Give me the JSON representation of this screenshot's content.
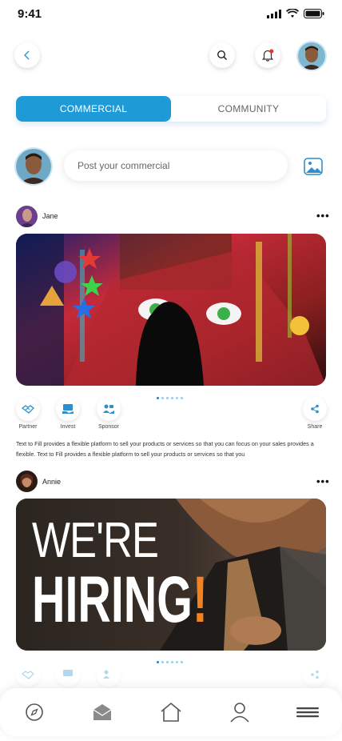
{
  "status": {
    "time": "9:41"
  },
  "tabs": [
    {
      "label": "COMMERCIAL",
      "active": true
    },
    {
      "label": "COMMUNITY",
      "active": false
    }
  ],
  "composer": {
    "placeholder": "Post your commercial"
  },
  "posts": [
    {
      "author": "Jane",
      "actions": [
        {
          "label": "Partner",
          "icon": "handshake-icon"
        },
        {
          "label": "Invest",
          "icon": "invest-icon"
        },
        {
          "label": "Sponsor",
          "icon": "sponsor-icon"
        }
      ],
      "share_label": "Share",
      "caption": "Text to Fill provides a flexible platform to sell your products or  services so that you can focus on your sales provides a flexible. Text to Fill provides a flexible platform to sell your products or  services so that you"
    },
    {
      "author": "Annie",
      "image_text": {
        "line1": "WE'RE",
        "line2": "HIRING",
        "mark": "!"
      }
    }
  ],
  "colors": {
    "accent": "#1e9bd7",
    "notification": "#e53935"
  },
  "nav": [
    {
      "name": "compass-icon"
    },
    {
      "name": "mail-icon"
    },
    {
      "name": "home-icon"
    },
    {
      "name": "profile-icon"
    },
    {
      "name": "menu-icon"
    }
  ]
}
